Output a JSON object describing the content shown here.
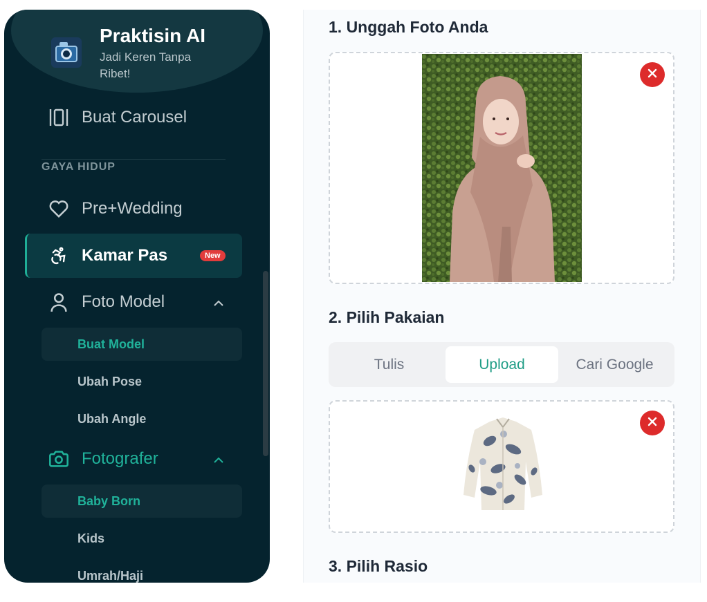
{
  "brand": {
    "title": "Praktisin AI",
    "subtitle": "Jadi Keren Tanpa Ribet!"
  },
  "sidebar": {
    "top_item": {
      "label": "Buat Carousel",
      "icon": "carousel-icon"
    },
    "section_label": "GAYA HIDUP",
    "items": [
      {
        "label": "Pre+Wedding",
        "icon": "heart-icon"
      },
      {
        "label": "Kamar Pas",
        "icon": "accessibility-icon",
        "badge": "New",
        "active": true
      },
      {
        "label": "Foto Model",
        "icon": "user-icon",
        "expanded": true,
        "children": [
          "Buat Model",
          "Ubah Pose",
          "Ubah Angle"
        ],
        "selected_child": "Buat Model"
      },
      {
        "label": "Fotografer",
        "icon": "camera-icon",
        "expanded": true,
        "children": [
          "Baby Born",
          "Kids",
          "Umrah/Haji"
        ],
        "selected_child": "Baby Born"
      }
    ]
  },
  "main": {
    "step1": {
      "title": "1. Unggah Foto Anda"
    },
    "step2": {
      "title": "2. Pilih Pakaian",
      "tabs": [
        "Tulis",
        "Upload",
        "Cari Google"
      ],
      "active_tab": "Upload"
    },
    "step3": {
      "title": "3. Pilih Rasio"
    }
  },
  "colors": {
    "sidebar_bg": "#05232e",
    "accent": "#1fae97",
    "remove": "#dd2b2b",
    "badge": "#e23c3c"
  }
}
